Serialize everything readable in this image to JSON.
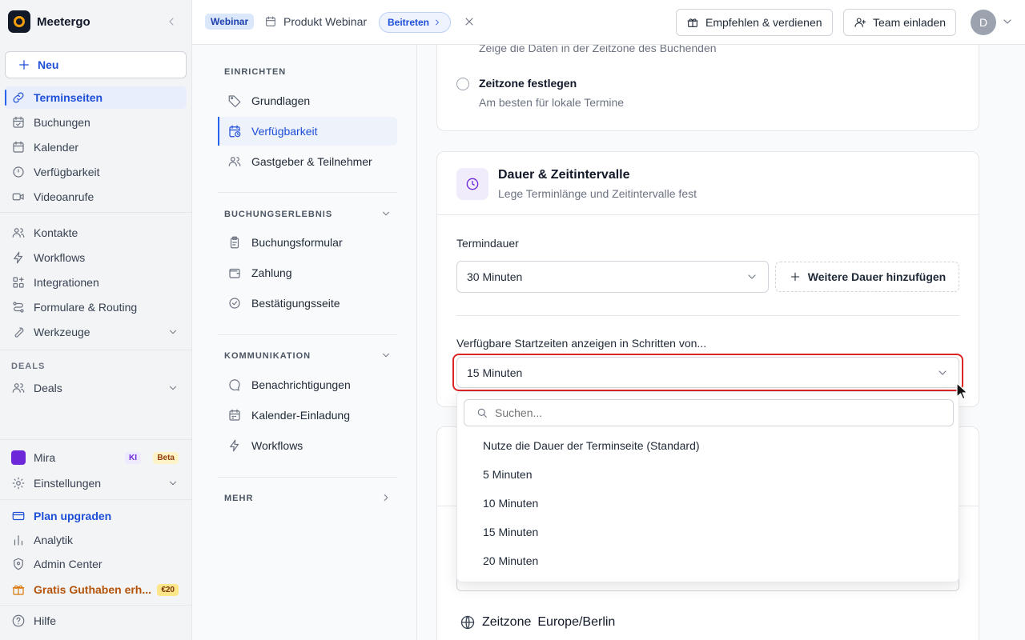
{
  "brand": {
    "name": "Meetergo"
  },
  "sidebar": {
    "new_label": "Neu",
    "items": [
      {
        "label": "Terminseiten",
        "icon": "link-icon"
      },
      {
        "label": "Buchungen",
        "icon": "calendar-check-icon"
      },
      {
        "label": "Kalender",
        "icon": "calendar-icon"
      },
      {
        "label": "Verfügbarkeit",
        "icon": "clock-icon"
      },
      {
        "label": "Videoanrufe",
        "icon": "video-icon"
      },
      {
        "label": "Kontakte",
        "icon": "users-icon"
      },
      {
        "label": "Workflows",
        "icon": "bolt-icon"
      },
      {
        "label": "Integrationen",
        "icon": "grid-plus-icon"
      },
      {
        "label": "Formulare & Routing",
        "icon": "route-icon"
      },
      {
        "label": "Werkzeuge",
        "icon": "wrench-icon"
      }
    ],
    "deals_section": "DEALS",
    "deals_label": "Deals",
    "mira_label": "Mira",
    "ki_badge": "KI",
    "beta_badge": "Beta",
    "settings_label": "Einstellungen",
    "upgrade_label": "Plan upgraden",
    "analytics_label": "Analytik",
    "admin_label": "Admin Center",
    "credit_label": "Gratis Guthaben erh...",
    "credit_badge": "€20",
    "help_label": "Hilfe"
  },
  "topbar": {
    "tag": "Webinar",
    "title": "Produkt Webinar",
    "join_label": "Beitreten",
    "recommend_label": "Empfehlen & verdienen",
    "invite_label": "Team einladen",
    "avatar_initial": "D"
  },
  "settings_nav": {
    "setup_section": "EINRICHTEN",
    "setup_items": [
      "Grundlagen",
      "Verfügbarkeit",
      "Gastgeber & Teilnehmer"
    ],
    "booking_section": "BUCHUNGSERLEBNIS",
    "booking_items": [
      "Buchungsformular",
      "Zahlung",
      "Bestätigungsseite"
    ],
    "comm_section": "KOMMUNIKATION",
    "comm_items": [
      "Benachrichtigungen",
      "Kalender-Einladung",
      "Workflows"
    ],
    "more_section": "MEHR"
  },
  "timezone_card": {
    "booker_desc": "Zeige die Daten in der Zeitzone des Buchenden",
    "fixed_title": "Zeitzone festlegen",
    "fixed_desc": "Am besten für lokale Termine"
  },
  "duration_card": {
    "title": "Dauer & Zeitintervalle",
    "subtitle": "Lege Terminlänge und Zeitintervalle fest",
    "duration_label": "Termindauer",
    "duration_value": "30 Minuten",
    "add_duration_label": "Weitere Dauer hinzufügen",
    "interval_label": "Verfügbare Startzeiten anzeigen in Schritten von...",
    "interval_value": "15 Minuten"
  },
  "dropdown": {
    "search_placeholder": "Suchen...",
    "options": [
      "Nutze die Dauer der Terminseite (Standard)",
      "5 Minuten",
      "10 Minuten",
      "15 Minuten",
      "20 Minuten"
    ]
  },
  "timezone_row": {
    "label": "Zeitzone",
    "value": "Europe/Berlin"
  },
  "colors": {
    "accent": "#1d4ed8",
    "highlight": "#dc2626",
    "purple": "#6d28d9"
  }
}
